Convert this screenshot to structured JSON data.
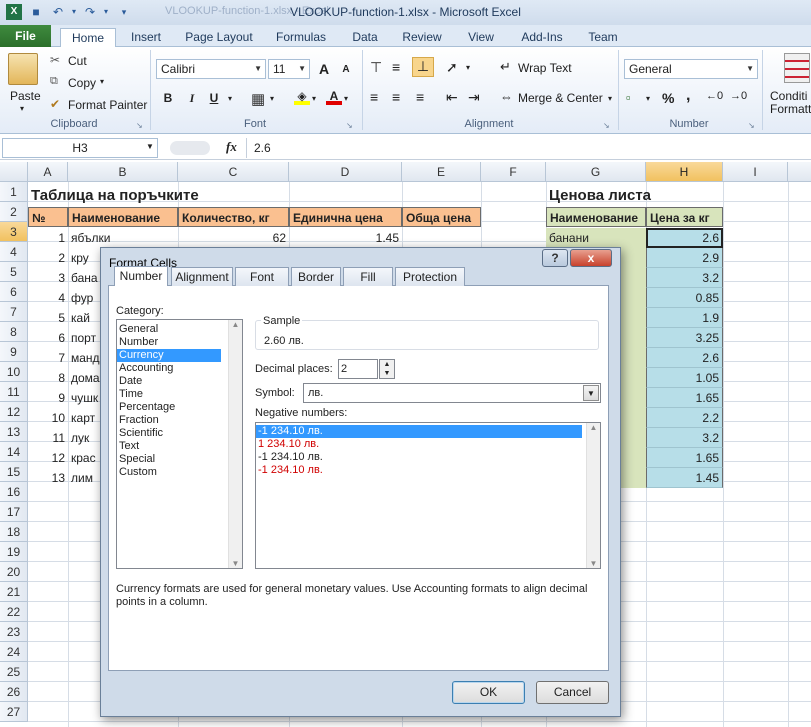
{
  "window": {
    "title": "VLOOKUP-function-1.xlsx  -  Microsoft Excel",
    "ghost_title": "VLOOKUP-function-1.xlsx - Excel"
  },
  "tabs": [
    {
      "id": "file",
      "label": "File"
    },
    {
      "id": "home",
      "label": "Home"
    },
    {
      "id": "insert",
      "label": "Insert"
    },
    {
      "id": "page_layout",
      "label": "Page Layout"
    },
    {
      "id": "formulas",
      "label": "Formulas"
    },
    {
      "id": "data",
      "label": "Data"
    },
    {
      "id": "review",
      "label": "Review"
    },
    {
      "id": "view",
      "label": "View"
    },
    {
      "id": "addins",
      "label": "Add-Ins"
    },
    {
      "id": "team",
      "label": "Team"
    }
  ],
  "ribbon": {
    "clipboard": {
      "paste": "Paste",
      "cut": "Cut",
      "copy": "Copy",
      "format_painter": "Format Painter",
      "label": "Clipboard"
    },
    "font": {
      "name": "Calibri",
      "size": "11",
      "label": "Font",
      "bold": "B",
      "italic": "I",
      "underline": "U",
      "grow": "A",
      "shrink": "A"
    },
    "alignment": {
      "wrap_text": "Wrap Text",
      "merge_center": "Merge & Center",
      "label": "Alignment"
    },
    "number": {
      "format": "General",
      "label": "Number",
      "percent": "%",
      "comma": ","
    },
    "styles": {
      "conditional": "Conditi",
      "formatting": "Formatti"
    }
  },
  "formula_bar": {
    "name_box": "H3",
    "fx": "fx",
    "value": "2.6"
  },
  "columns": [
    "A",
    "B",
    "C",
    "D",
    "E",
    "F",
    "G",
    "H",
    "I"
  ],
  "rows": [
    "1",
    "2",
    "3",
    "4",
    "5",
    "6",
    "7",
    "8",
    "9",
    "10",
    "11",
    "12",
    "13",
    "14",
    "15",
    "16",
    "17",
    "18",
    "19",
    "20",
    "21",
    "22",
    "23",
    "24",
    "25",
    "26",
    "27"
  ],
  "sheet": {
    "order_title": "Таблица на поръчките",
    "price_title": "Ценова листа",
    "order_headers": [
      "№",
      "Наименование",
      "Количество, кг",
      "Единична цена",
      "Обща цена"
    ],
    "price_headers": [
      "Наименование",
      "Цена за кг"
    ],
    "row3": {
      "num": "1",
      "name": "ябълки",
      "qty": "62",
      "price": "1.45"
    },
    "order_nums": [
      "2",
      "3",
      "4",
      "5",
      "6",
      "7",
      "8",
      "9",
      "10",
      "11",
      "12",
      "13"
    ],
    "order_names_partial": [
      "кру",
      "бана",
      "фур",
      "кай",
      "порт",
      "манд",
      "дома",
      "чушк",
      "карт",
      "лук",
      "крас",
      "лим"
    ],
    "price_first_name": "банани",
    "prices": [
      "2.6",
      "2.9",
      "3.2",
      "0.85",
      "1.9",
      "3.25",
      "2.6",
      "1.05",
      "1.65",
      "2.2",
      "3.2",
      "1.65",
      "1.45"
    ]
  },
  "dialog": {
    "title": "Format Cells",
    "help": "?",
    "close": "x",
    "tabs": [
      "Number",
      "Alignment",
      "Font",
      "Border",
      "Fill",
      "Protection"
    ],
    "category_label": "Category:",
    "categories": [
      "General",
      "Number",
      "Currency",
      "Accounting",
      "Date",
      "Time",
      "Percentage",
      "Fraction",
      "Scientific",
      "Text",
      "Special",
      "Custom"
    ],
    "selected_category": "Currency",
    "sample_label": "Sample",
    "sample_value": "2.60 лв.",
    "decimal_label": "Decimal places:",
    "decimal_value": "2",
    "symbol_label": "Symbol:",
    "symbol_value": "лв.",
    "negative_label": "Negative numbers:",
    "negatives": [
      {
        "text": "-1 234.10 лв.",
        "red": false,
        "selected": true
      },
      {
        "text": "1 234.10 лв.",
        "red": true,
        "selected": false
      },
      {
        "text": "-1 234.10 лв.",
        "red": false,
        "selected": false
      },
      {
        "text": "-1 234.10 лв.",
        "red": true,
        "selected": false
      }
    ],
    "description": "Currency formats are used for general monetary values.  Use Accounting formats to align decimal points in a column.",
    "ok": "OK",
    "cancel": "Cancel"
  },
  "colors": {
    "header_orange": "#fac090",
    "header_green": "#d8e4bc",
    "price_blue": "#b7dee8",
    "file_tab": "#2b6f2b"
  }
}
